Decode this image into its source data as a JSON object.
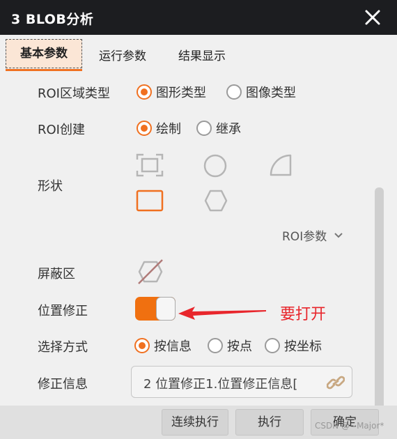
{
  "window": {
    "title": "3 BLOB分析",
    "close_icon": "close-icon"
  },
  "tabs": [
    {
      "label": "基本参数",
      "active": true
    },
    {
      "label": "运行参数",
      "active": false
    },
    {
      "label": "结果显示",
      "active": false
    }
  ],
  "form": {
    "roi_region_type": {
      "label": "ROI区域类型",
      "options": [
        {
          "label": "图形类型",
          "selected": true
        },
        {
          "label": "图像类型",
          "selected": false
        }
      ]
    },
    "roi_create": {
      "label": "ROI创建",
      "options": [
        {
          "label": "绘制",
          "selected": true
        },
        {
          "label": "继承",
          "selected": false
        }
      ]
    },
    "shape": {
      "label": "形状",
      "icons": [
        "box-select-icon",
        "circle-icon",
        "quarter-circle-icon",
        "rectangle-icon",
        "hexagon-icon"
      ],
      "selected": "rectangle-icon"
    },
    "roi_params": {
      "label": "ROI参数"
    },
    "mask_area": {
      "label": "屏蔽区",
      "icon": "mask-icon"
    },
    "position_fix": {
      "label": "位置修正",
      "enabled": true
    },
    "annotation": {
      "text": "要打开",
      "color": "#e8262c"
    },
    "select_mode": {
      "label": "选择方式",
      "options": [
        {
          "label": "按信息",
          "selected": true
        },
        {
          "label": "按点",
          "selected": false
        },
        {
          "label": "按坐标",
          "selected": false
        }
      ]
    },
    "fix_info": {
      "label": "修正信息",
      "value": "2 位置修正1.位置修正信息[",
      "icon": "link-icon"
    }
  },
  "footer": {
    "buttons": [
      "连续执行",
      "执行",
      "确定"
    ]
  },
  "watermark": "CSDN @~Major*",
  "colors": {
    "accent": "#f07020",
    "titlebar": "#1c1d20",
    "annotation": "#e8262c"
  }
}
